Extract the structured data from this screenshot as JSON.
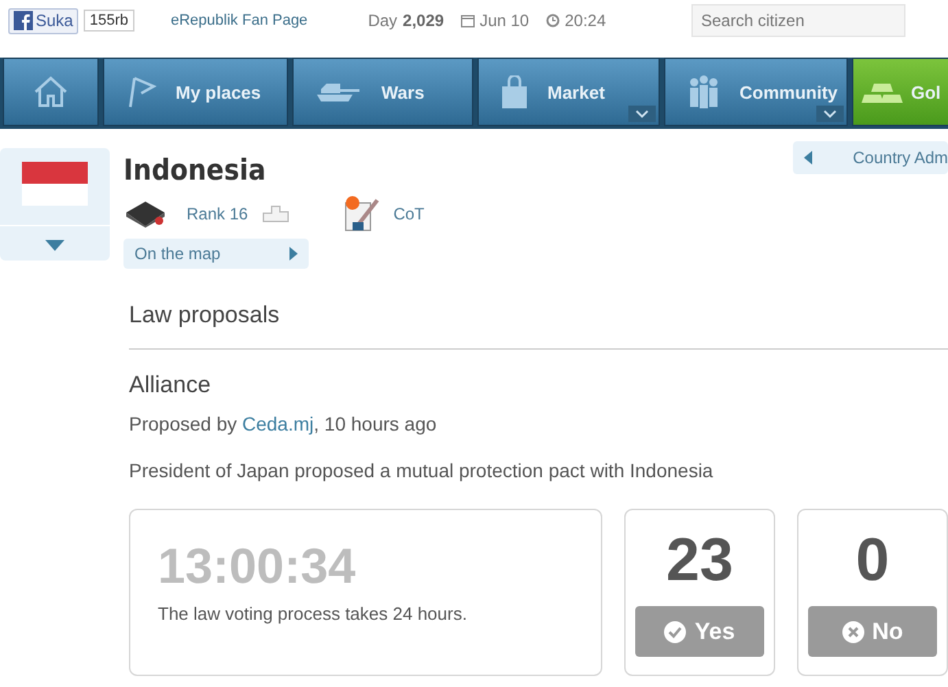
{
  "top_bar": {
    "like_button": "Suka",
    "like_count": "155rb",
    "fan_page_link": "eRepublik Fan Page",
    "day_label": "Day",
    "day": "2,029",
    "date": "Jun 10",
    "time": "20:24",
    "search": {
      "placeholder": "Search citizen"
    }
  },
  "nav": [
    {
      "kind": "home",
      "dropdown": false
    },
    {
      "kind": "places",
      "label": "My places",
      "dropdown": false
    },
    {
      "kind": "wars",
      "label": "Wars",
      "dropdown": false
    },
    {
      "kind": "market",
      "label": "Market",
      "dropdown": true
    },
    {
      "kind": "community",
      "label": "Community",
      "dropdown": true
    },
    {
      "kind": "gold",
      "label": "Gol",
      "dropdown": false
    }
  ],
  "country": {
    "name": "Indonesia",
    "rank": "Rank 16",
    "cot": "CoT",
    "map_link": "On the map",
    "admin_link": "Country Adm"
  },
  "section_title": "Law proposals",
  "proposal": {
    "title": "Alliance",
    "proposed_by": "Proposed by",
    "author": "Ceda.mj",
    "ago": ", 10 hours ago",
    "description": "President of Japan proposed a mutual protection pact with Indonesia",
    "countdown": "13:00:34",
    "countdown_note": "The law voting process takes 24 hours.",
    "votes": [
      {
        "kind": "yes",
        "count": "23",
        "label": "Yes",
        "disabled": true
      },
      {
        "kind": "no",
        "count": "0",
        "label": "No",
        "disabled": true
      }
    ]
  }
}
